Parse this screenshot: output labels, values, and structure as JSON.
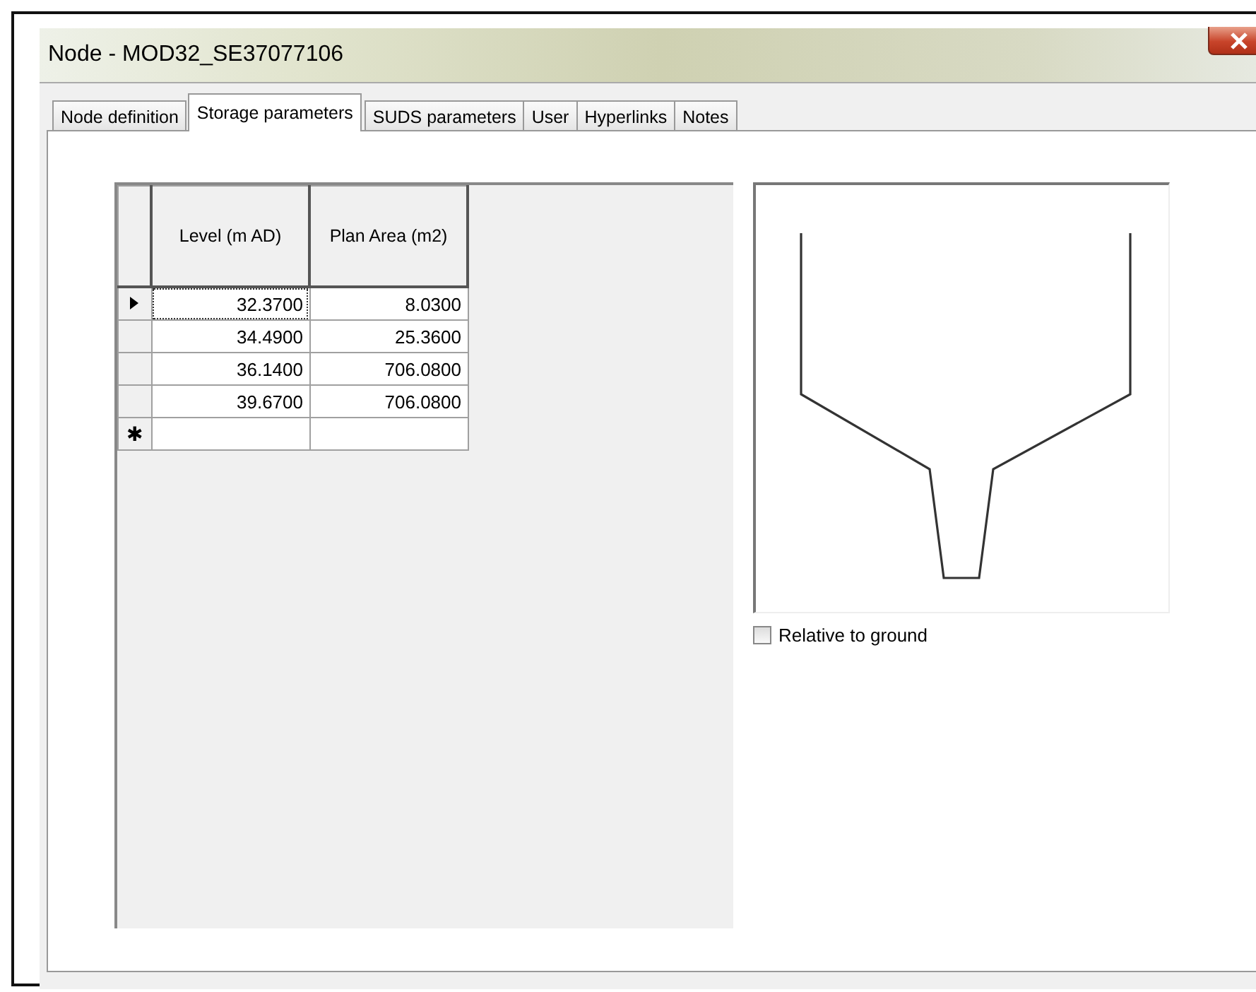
{
  "window": {
    "title": "Node - MOD32_SE37077106"
  },
  "tabs": [
    {
      "label": "Node definition",
      "selected": false
    },
    {
      "label": "Storage parameters",
      "selected": true
    },
    {
      "label": "SUDS parameters",
      "selected": false
    },
    {
      "label": "User",
      "selected": false
    },
    {
      "label": "Hyperlinks",
      "selected": false
    },
    {
      "label": "Notes",
      "selected": false
    }
  ],
  "table": {
    "columns": [
      "Level (m AD)",
      "Plan Area (m2)"
    ],
    "rows": [
      {
        "selected": true,
        "cells": [
          "32.3700",
          "8.0300"
        ]
      },
      {
        "selected": false,
        "cells": [
          "34.4900",
          "25.3600"
        ]
      },
      {
        "selected": false,
        "cells": [
          "36.1400",
          "706.0800"
        ]
      },
      {
        "selected": false,
        "cells": [
          "39.6700",
          "706.0800"
        ]
      }
    ],
    "new_row_marker": "✱"
  },
  "relative_to_ground": {
    "label": "Relative to ground",
    "checked": false
  }
}
